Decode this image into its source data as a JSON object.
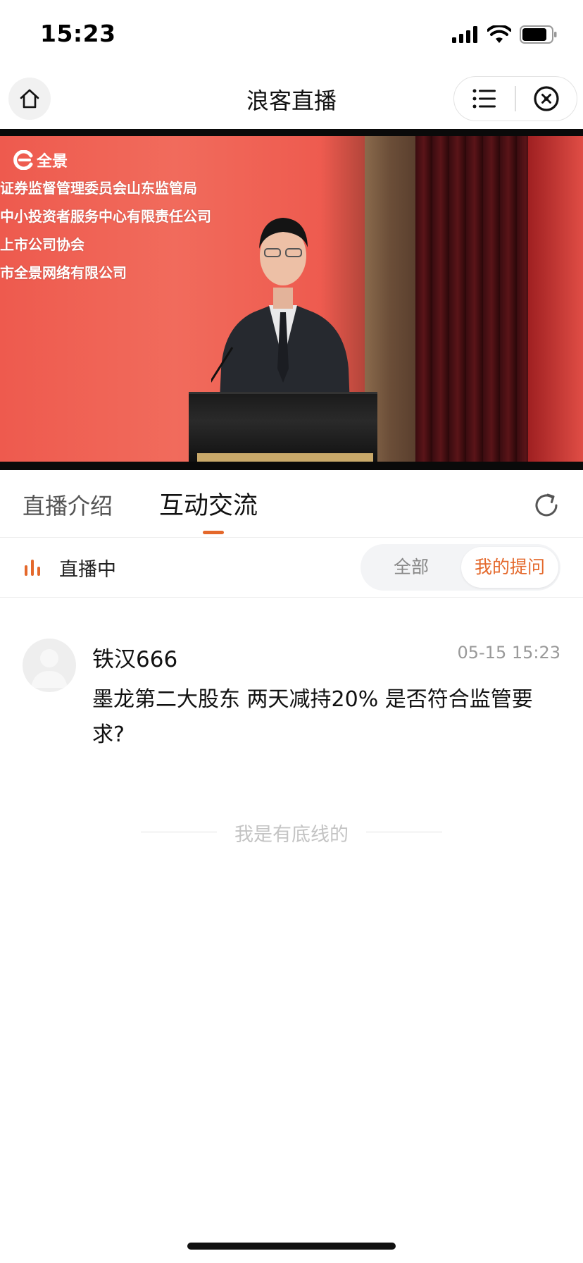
{
  "status_bar": {
    "time": "15:23"
  },
  "nav": {
    "title": "浪客直播"
  },
  "video": {
    "logo_text": "全景",
    "banner_lines": [
      "证券监督管理委员会山东监管局",
      "中小投资者服务中心有限责任公司",
      "上市公司协会",
      "市全景网络有限公司"
    ]
  },
  "tabs": {
    "intro": "直播介绍",
    "interact": "互动交流",
    "active": "互动交流"
  },
  "live_bar": {
    "status": "直播中",
    "filter_all": "全部",
    "filter_mine": "我的提问",
    "selected_filter": "我的提问"
  },
  "question": {
    "user": "铁汉666",
    "time": "05-15 15:23",
    "text": "墨龙第二大股东 两天减持20% 是否符合监管要求?"
  },
  "bottom_text": "我是有底线的",
  "colors": {
    "accent": "#e4682b",
    "banner_red": "#ee5a4e"
  }
}
